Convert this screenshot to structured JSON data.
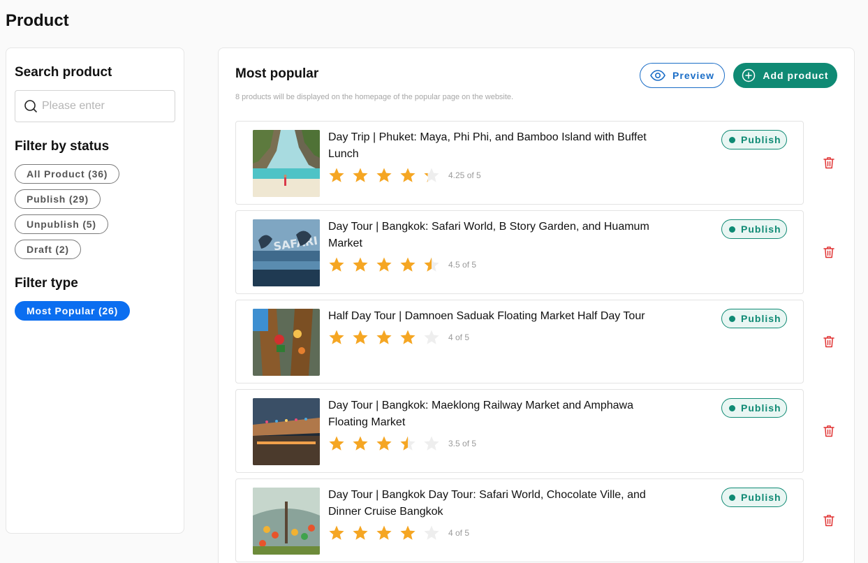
{
  "page": {
    "title": "Product"
  },
  "sidebar": {
    "search_heading": "Search product",
    "search_placeholder": "Please enter",
    "search_value": "",
    "status_heading": "Filter by status",
    "status_chips": [
      {
        "label": "All Product (36)"
      },
      {
        "label": "Publish (29)"
      },
      {
        "label": "Unpublish (5)"
      },
      {
        "label": "Draft (2)"
      }
    ],
    "type_heading": "Filter type",
    "type_chips": [
      {
        "label": "Most Popular (26)",
        "active": true
      }
    ]
  },
  "main": {
    "title": "Most popular",
    "subtitle": "8 products will be displayed on the homepage of the popular page on the website.",
    "preview_label": "Preview",
    "add_label": "Add product",
    "products": [
      {
        "title": "Day Trip | Phuket: Maya, Phi Phi, and Bamboo Island with Buffet Lunch",
        "rating": 4.25,
        "rating_text": "4.25 of 5",
        "status": "Publish",
        "thumb": "beach-cove"
      },
      {
        "title": "Day Tour | Bangkok: Safari World, B Story Garden, and Huamum Market",
        "rating": 4.5,
        "rating_text": "4.5 of 5",
        "status": "Publish",
        "thumb": "dolphin-show"
      },
      {
        "title": "Half Day Tour | Damnoen Saduak Floating Market Half Day Tour",
        "rating": 4,
        "rating_text": "4 of 5",
        "status": "Publish",
        "thumb": "floating-market"
      },
      {
        "title": "Day Tour | Bangkok: Maeklong Railway Market and Amphawa Floating Market",
        "rating": 3.5,
        "rating_text": "3.5 of 5",
        "status": "Publish",
        "thumb": "railway-market"
      },
      {
        "title": "Day Tour | Bangkok Day Tour: Safari World, Chocolate Ville, and Dinner Cruise Bangkok",
        "rating": 4,
        "rating_text": "4 of 5",
        "status": "Publish",
        "thumb": "parrots"
      }
    ]
  },
  "colors": {
    "accent_blue": "#0b6ef0",
    "accent_green": "#0f8a74",
    "star": "#f5a623",
    "star_empty": "#eeeeee",
    "delete": "#e03131"
  },
  "icons": {
    "search": "search-icon",
    "preview": "eye-icon",
    "add": "plus-circle-icon",
    "delete": "trash-icon",
    "status": "dot-icon",
    "rating": "star-icon"
  }
}
